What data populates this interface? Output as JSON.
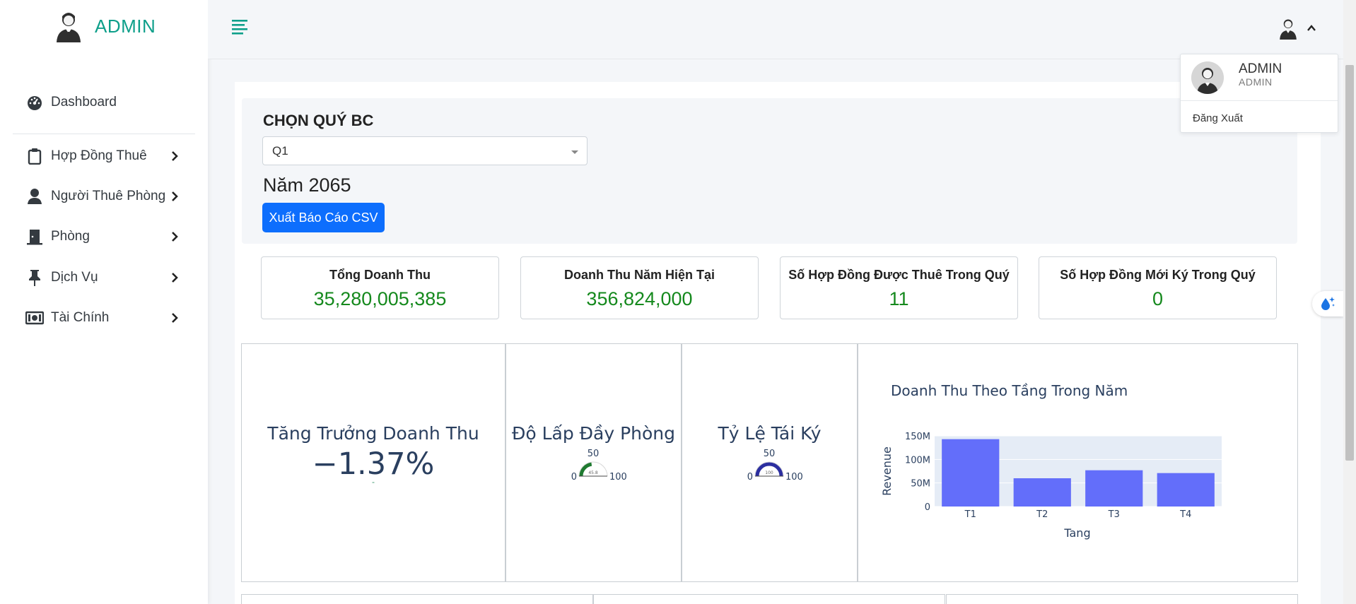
{
  "brand": {
    "name": "ADMIN"
  },
  "sidebar": {
    "items": [
      {
        "label": "Dashboard",
        "icon": "dashboard-gauge-icon",
        "has_children": false
      },
      {
        "label": "Hợp Đồng Thuê",
        "icon": "clipboard-icon",
        "has_children": true
      },
      {
        "label": "Người Thuê Phòng",
        "icon": "user-icon",
        "has_children": true
      },
      {
        "label": "Phòng",
        "icon": "door-icon",
        "has_children": true
      },
      {
        "label": "Dịch Vụ",
        "icon": "pin-icon",
        "has_children": true
      },
      {
        "label": "Tài Chính",
        "icon": "money-bill-icon",
        "has_children": true
      }
    ]
  },
  "topbar": {
    "menu_icon": "hamburger-icon",
    "user_icon": "user-avatar-icon",
    "dropdown_open": true
  },
  "user_dropdown": {
    "name": "ADMIN",
    "role": "ADMIN",
    "logout_label": "Đăng Xuất"
  },
  "filter": {
    "label": "CHỌN QUÝ BC",
    "selected_quarter": "Q1",
    "year_label": "Năm 2065",
    "export_button": "Xuất Báo Cáo CSV"
  },
  "kpis": [
    {
      "label": "Tổng Doanh Thu",
      "value": "35,280,005,385"
    },
    {
      "label": "Doanh Thu Năm Hiện Tại",
      "value": "356,824,000"
    },
    {
      "label": "Số Hợp Đồng Được Thuê Trong Quý",
      "value": "11"
    },
    {
      "label": "Số Hợp Đồng Mới Ký Trong Quý",
      "value": "0"
    }
  ],
  "colors": {
    "accent": "#0e9f8a",
    "primary_button": "#0d6efd",
    "kpi_value": "#15891d",
    "bar": "#636efa",
    "plot_bg": "#e5ecf6",
    "gauge1": "#1f7a30",
    "gauge2": "#2c2fa0"
  },
  "indicators": {
    "growth": {
      "title": "Tăng Trưởng Doanh Thu",
      "value_text": "−1.37%",
      "delta_text": "-"
    },
    "occupancy": {
      "title": "Độ Lấp Đầy Phòng",
      "min_label": "0",
      "max_label": "100",
      "mid_label": "50",
      "value": 45.8,
      "value_text": "45.8"
    },
    "renewal": {
      "title": "Tỷ Lệ Tái Ký",
      "min_label": "0",
      "max_label": "100",
      "mid_label": "50",
      "value": 100,
      "value_text": "100"
    }
  },
  "chart_data": {
    "type": "bar",
    "title": "Doanh Thu Theo Tầng Trong Năm",
    "xlabel": "Tang",
    "ylabel": "Revenue",
    "categories": [
      "T1",
      "T2",
      "T3",
      "T4"
    ],
    "values": [
      143000000,
      60000000,
      77000000,
      71000000
    ],
    "ylim": [
      0,
      150000000
    ],
    "yticks": [
      0,
      50000000,
      100000000,
      150000000
    ],
    "ytick_labels": [
      "0",
      "50M",
      "100M",
      "150M"
    ],
    "grid": true
  }
}
